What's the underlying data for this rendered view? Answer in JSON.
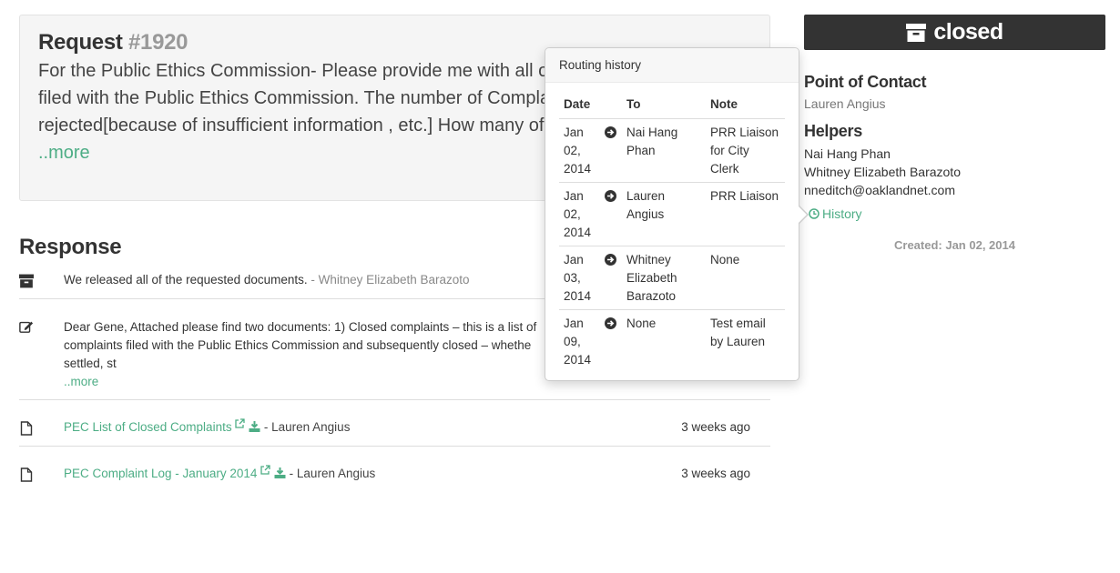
{
  "request": {
    "label": "Request",
    "number": "#1920",
    "text_lines": [
      "For the Public Ethics Commission- Please provide me with all of",
      "filed with the Public Ethics Commission. The number of Complai",
      "rejected[because of insufficient information , etc.] How many of"
    ],
    "more_label": "..more"
  },
  "response": {
    "heading": "Response",
    "items": [
      {
        "icon": "archive-icon",
        "text": "We released all of the requested documents.",
        "author": " - Whitney Elizabeth Barazoto"
      },
      {
        "icon": "edit-icon",
        "text_lines": [
          "Dear Gene, Attached please find two documents: 1) Closed complaints – this is a list of",
          "complaints filed with the Public Ethics Commission and subsequently closed – whethe",
          "settled, st"
        ],
        "more_label": "..more"
      },
      {
        "icon": "file-icon",
        "link": "PEC List of Closed Complaints",
        "author": " - Lauren Angius",
        "time": "3 weeks ago"
      },
      {
        "icon": "file-icon",
        "link": "PEC Complaint Log - January 2014",
        "author": " - Lauren Angius",
        "time": "3 weeks ago"
      }
    ]
  },
  "sidebar": {
    "status": "closed",
    "status_icon": "archive-icon",
    "point_of_contact_heading": "Point of Contact",
    "point_of_contact": "Lauren Angius",
    "helpers_heading": "Helpers",
    "helpers": [
      "Nai Hang Phan",
      "Whitney Elizabeth Barazoto",
      "nneditch@oaklandnet.com"
    ],
    "history_label": "History",
    "created": "Created: Jan 02, 2014"
  },
  "routing_history": {
    "title": "Routing history",
    "columns": [
      "Date",
      "To",
      "Note"
    ],
    "rows": [
      {
        "date": [
          "Jan",
          "02,",
          "2014"
        ],
        "to": "Nai Hang Phan",
        "note": "PRR Liaison for City Clerk"
      },
      {
        "date": [
          "Jan",
          "02,",
          "2014"
        ],
        "to": "Lauren Angius",
        "note": "PRR Liaison"
      },
      {
        "date": [
          "Jan",
          "03,",
          "2014"
        ],
        "to": "Whitney Elizabeth Barazoto",
        "note": "None"
      },
      {
        "date": [
          "Jan",
          "09,",
          "2014"
        ],
        "to": "None",
        "note": "Test email by Lauren"
      }
    ]
  },
  "colors": {
    "accent": "#4dad85",
    "banner": "#333333",
    "muted": "#999999"
  }
}
